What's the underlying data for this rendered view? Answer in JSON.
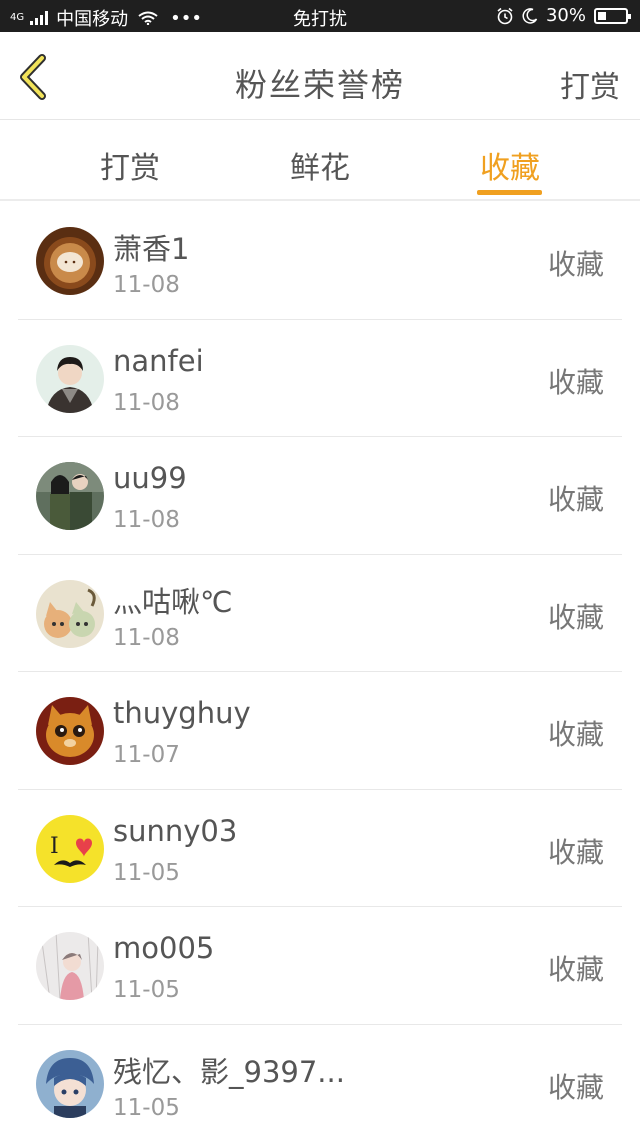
{
  "status_bar": {
    "network_label": "4G",
    "carrier": "中国移动",
    "dots": "•••",
    "center_text": "免打扰",
    "battery": "30%",
    "battery_level": 0.3
  },
  "nav": {
    "title": "粉丝荣誉榜",
    "right_action": "打赏"
  },
  "tabs": [
    {
      "label": "打赏",
      "active": false
    },
    {
      "label": "鲜花",
      "active": false
    },
    {
      "label": "收藏",
      "active": true
    }
  ],
  "list": [
    {
      "name": "萧香1",
      "date": "11-08",
      "action": "收藏",
      "avatar": "coffee-avatar"
    },
    {
      "name": "nanfei",
      "date": "11-08",
      "action": "收藏",
      "avatar": "person-avatar"
    },
    {
      "name": "uu99",
      "date": "11-08",
      "action": "收藏",
      "avatar": "couple-avatar"
    },
    {
      "name": "灬咕啾℃",
      "date": "11-08",
      "action": "收藏",
      "avatar": "anime-cat-avatar"
    },
    {
      "name": "thuyghuy",
      "date": "11-07",
      "action": "收藏",
      "avatar": "cat-avatar"
    },
    {
      "name": "sunny03",
      "date": "11-05",
      "action": "收藏",
      "avatar": "i-love-mustache-avatar"
    },
    {
      "name": "mo005",
      "date": "11-05",
      "action": "收藏",
      "avatar": "sketch-girl-avatar"
    },
    {
      "name": "残忆、影_9397...",
      "date": "11-05",
      "action": "收藏",
      "avatar": "anime-boy-avatar"
    }
  ],
  "colors": {
    "accent": "#f0a020",
    "status_bar_bg": "#1f1f1f",
    "text_primary": "#555555",
    "text_secondary": "#999999"
  }
}
